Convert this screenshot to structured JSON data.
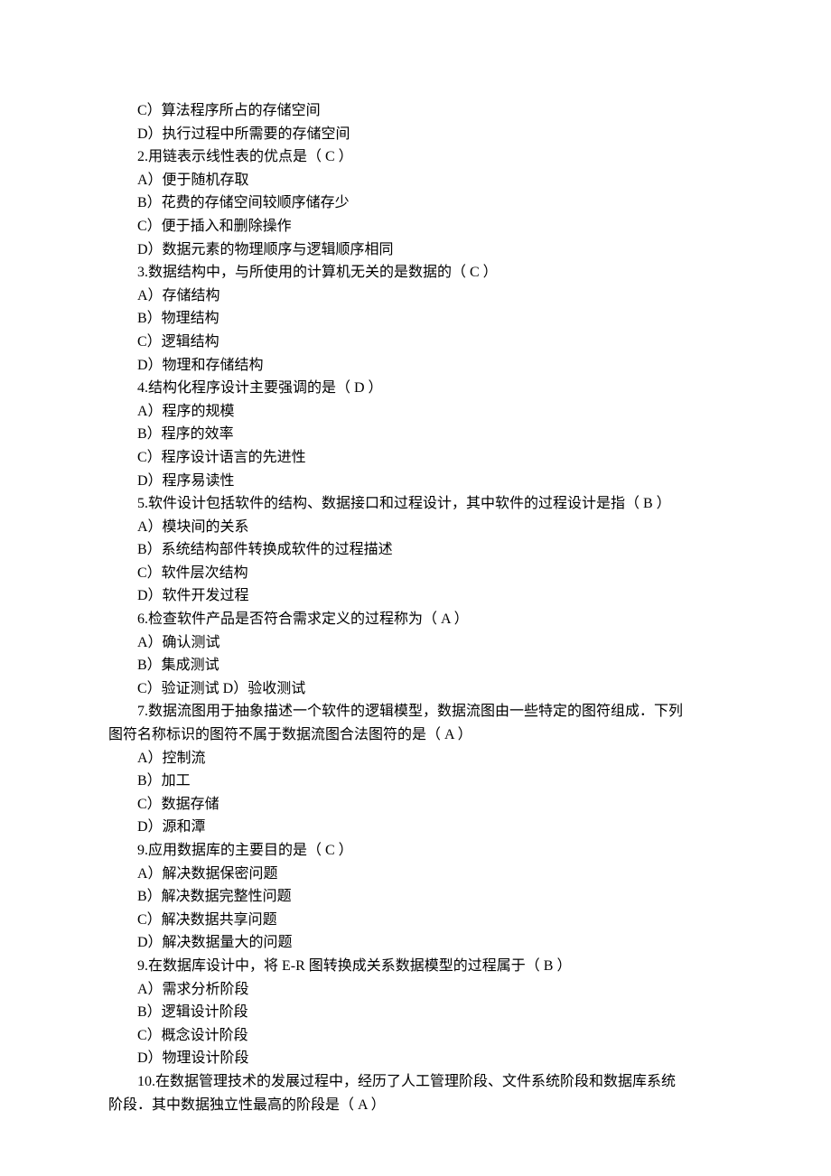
{
  "lines": [
    "C）算法程序所占的存储空间",
    "D）执行过程中所需要的存储空间",
    "2.用链表示线性表的优点是（   C   ）",
    "A）便于随机存取",
    "B）花费的存储空间较顺序储存少",
    "C）便于插入和删除操作",
    "D）数据元素的物理顺序与逻辑顺序相同",
    "3.数据结构中，与所使用的计算机无关的是数据的（   C   ）",
    "A）存储结构",
    "B）物理结构",
    "C）逻辑结构",
    "D）物理和存储结构",
    "4.结构化程序设计主要强调的是（   D   ）",
    "A）程序的规模",
    "B）程序的效率",
    "C）程序设计语言的先进性",
    "D）程序易读性",
    "5.软件设计包括软件的结构、数据接口和过程设计，其中软件的过程设计是指（   B   ）",
    "A）模块间的关系",
    "B）系统结构部件转换成软件的过程描述",
    "C）软件层次结构",
    "D）软件开发过程",
    "6.检查软件产品是否符合需求定义的过程称为（   A   ）",
    "A）确认测试",
    "B）集成测试",
    "C）验证测试   D）验收测试",
    "7.数据流图用于抽象描述一个软件的逻辑模型，数据流图由一些特定的图符组成．下列"
  ],
  "line_noindent_1": "图符名称标识的图符不属于数据流图合法图符的是（   A   ）",
  "lines2": [
    "A）控制流",
    "B）加工",
    "C）数据存储",
    "D）源和潭",
    "9.应用数据库的主要目的是（   C   ）",
    "A）解决数据保密问题",
    "B）解决数据完整性问题",
    "C）解决数据共享问题",
    "D）解决数据量大的问题",
    "9.在数据库设计中，将 E-R 图转换成关系数据模型的过程属于（   B   ）",
    "A）需求分析阶段",
    "B）逻辑设计阶段",
    "C）概念设计阶段",
    "D）物理设计阶段",
    "10.在数据管理技术的发展过程中，经历了人工管理阶段、文件系统阶段和数据库系统"
  ],
  "line_noindent_2": "阶段．其中数据独立性最高的阶段是（   A   ）"
}
